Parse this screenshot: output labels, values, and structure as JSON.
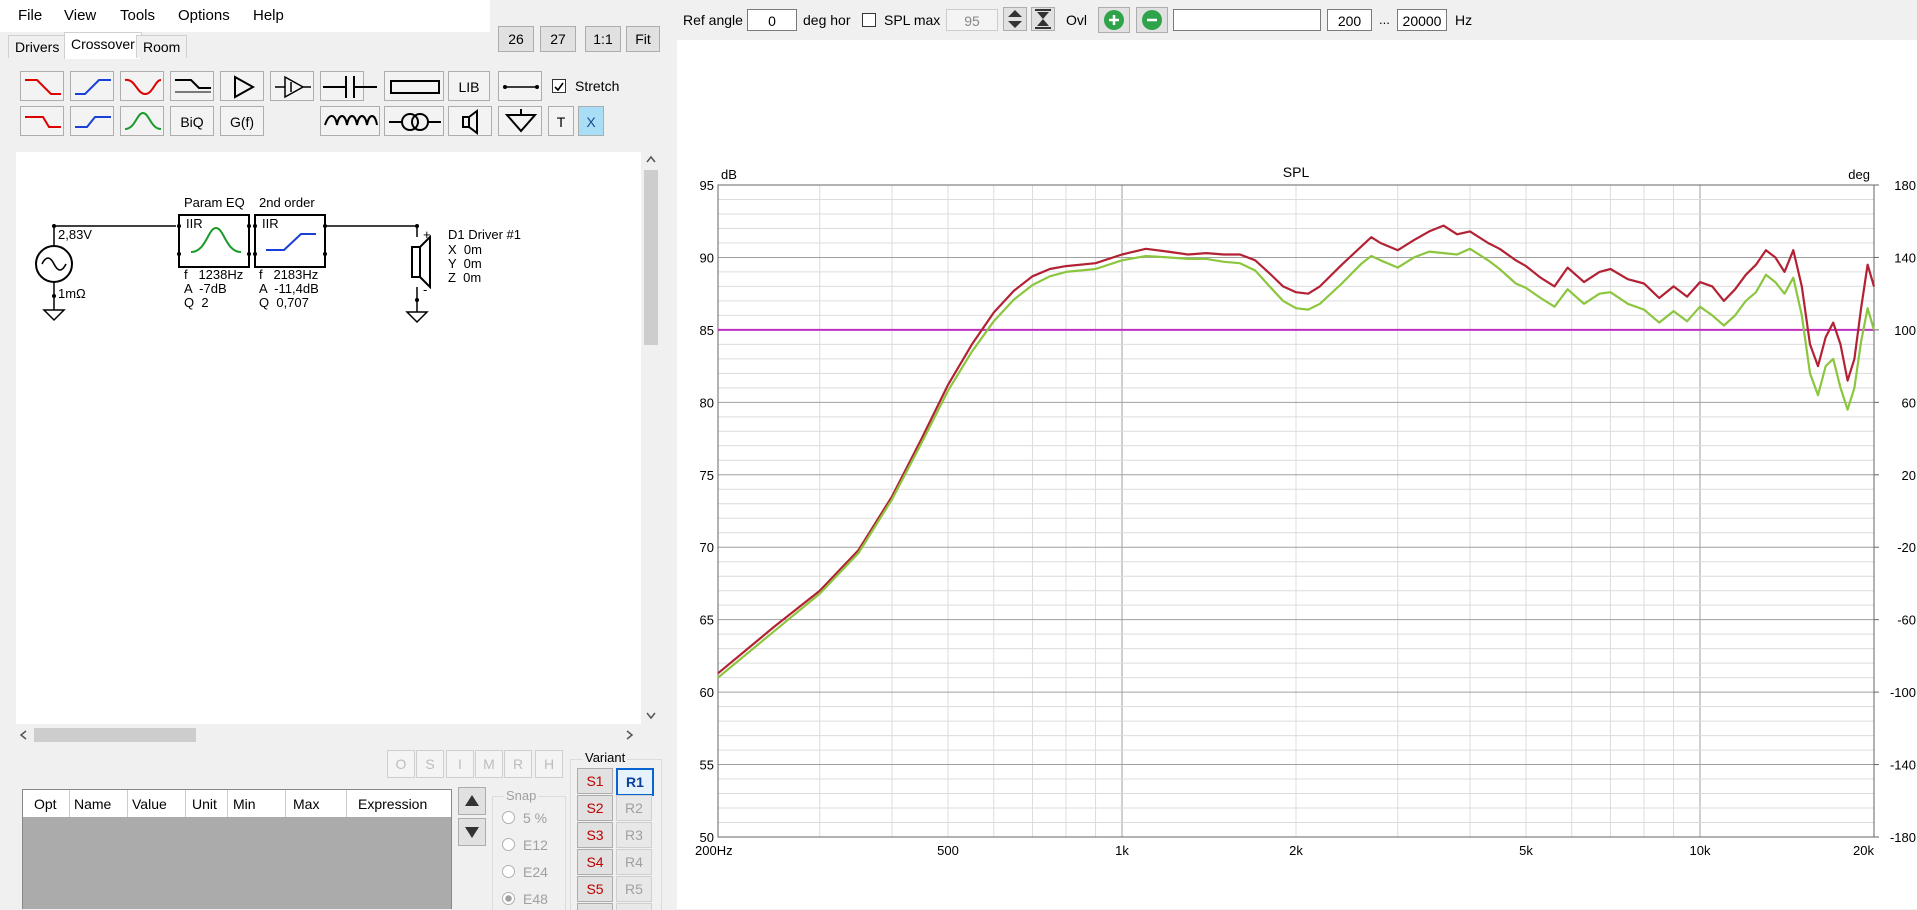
{
  "menu": {
    "items": [
      "File",
      "View",
      "Tools",
      "Options",
      "Help"
    ]
  },
  "tabs": [
    "Drivers",
    "Crossover",
    "Room"
  ],
  "view_buttons": {
    "b1": "26",
    "b2": "27",
    "b3": "1:1",
    "b4": "Fit"
  },
  "toolbar": {
    "lib": "LIB",
    "biq": "BiQ",
    "gf": "G(f)",
    "t": "T",
    "x": "X",
    "stretch_label": "Stretch",
    "stretch_checked": true
  },
  "schematic": {
    "source_voltage": "2,83V",
    "source_impedance": "1mΩ",
    "block1": {
      "title": "Param EQ",
      "type": "IIR",
      "f": "f   1238Hz",
      "a": "A  -7dB",
      "q": "Q  2"
    },
    "block2": {
      "title": "2nd order",
      "type": "IIR",
      "f": "f   2183Hz",
      "a": "A  -11,4dB",
      "q": "Q  0,707"
    },
    "driver": {
      "name": "D1 Driver #1",
      "x": "X  0m",
      "y": "Y  0m",
      "z": "Z  0m",
      "plus": "+",
      "minus": "-"
    }
  },
  "opt_buttons": [
    "O",
    "S",
    "I",
    "M",
    "R",
    "H"
  ],
  "param_grid": {
    "columns": [
      "Opt",
      "Name",
      "Value",
      "Unit",
      "Min",
      "Max",
      "Expression"
    ]
  },
  "snap": {
    "label": "Snap",
    "options": [
      "5 %",
      "E12",
      "E24",
      "E48"
    ],
    "selected": "E48"
  },
  "variant": {
    "label": "Variant",
    "s": [
      "S1",
      "S2",
      "S3",
      "S4",
      "S5"
    ],
    "r": [
      "R1",
      "R2",
      "R3",
      "R4",
      "R5"
    ],
    "active_r": "R1"
  },
  "topbar": {
    "ref_angle_label": "Ref angle",
    "ref_angle_value": "0",
    "deg_hor_label": "deg hor",
    "spl_max_label": "SPL max",
    "spl_max_value": "95",
    "ovl_label": "Ovl",
    "freq_text": "",
    "freq_min": "200",
    "ellipsis": "...",
    "freq_max": "20000",
    "hz_label": "Hz"
  },
  "colors": {
    "series1": "#b22234",
    "series2": "#8cc63f",
    "ref_line": "#c030c0",
    "grid_major": "#a0a0a0",
    "grid_minor": "#dcdcdc"
  },
  "chart_data": {
    "type": "line",
    "title": "SPL",
    "ylabel_left": "dB",
    "ylabel_right": "deg",
    "x_scale": "log",
    "xlim": [
      200,
      20000
    ],
    "ylim_left": [
      50,
      95
    ],
    "ylim_right": [
      -180,
      180
    ],
    "x_tick_labels": [
      {
        "v": 200,
        "t": "200Hz"
      },
      {
        "v": 500,
        "t": "500"
      },
      {
        "v": 1000,
        "t": "1k"
      },
      {
        "v": 2000,
        "t": "2k"
      },
      {
        "v": 5000,
        "t": "5k"
      },
      {
        "v": 10000,
        "t": "10k"
      },
      {
        "v": 20000,
        "t": "20k"
      }
    ],
    "y_left_ticks": [
      95,
      90,
      85,
      80,
      75,
      70,
      65,
      60,
      55,
      50
    ],
    "y_right_ticks": [
      180,
      140,
      100,
      60,
      20,
      -20,
      -60,
      -100,
      -140,
      -180
    ],
    "ref_line": 85,
    "series": [
      {
        "color": "#b22234",
        "points": [
          [
            200,
            61.3
          ],
          [
            250,
            64.5
          ],
          [
            300,
            67
          ],
          [
            350,
            69.8
          ],
          [
            400,
            73.5
          ],
          [
            450,
            77.5
          ],
          [
            500,
            81.2
          ],
          [
            550,
            84
          ],
          [
            600,
            86.2
          ],
          [
            650,
            87.7
          ],
          [
            700,
            88.7
          ],
          [
            750,
            89.2
          ],
          [
            800,
            89.4
          ],
          [
            900,
            89.6
          ],
          [
            1000,
            90.2
          ],
          [
            1100,
            90.6
          ],
          [
            1200,
            90.4
          ],
          [
            1300,
            90.2
          ],
          [
            1400,
            90.3
          ],
          [
            1500,
            90.2
          ],
          [
            1600,
            90.2
          ],
          [
            1700,
            89.8
          ],
          [
            1800,
            88.9
          ],
          [
            1900,
            88.0
          ],
          [
            2000,
            87.6
          ],
          [
            2100,
            87.5
          ],
          [
            2200,
            88.0
          ],
          [
            2400,
            89.5
          ],
          [
            2600,
            90.8
          ],
          [
            2700,
            91.4
          ],
          [
            2800,
            91.0
          ],
          [
            3000,
            90.5
          ],
          [
            3200,
            91.2
          ],
          [
            3400,
            91.8
          ],
          [
            3600,
            92.2
          ],
          [
            3800,
            91.6
          ],
          [
            4000,
            91.8
          ],
          [
            4300,
            91.0
          ],
          [
            4500,
            90.6
          ],
          [
            4800,
            89.8
          ],
          [
            5000,
            89.4
          ],
          [
            5300,
            88.6
          ],
          [
            5600,
            88.0
          ],
          [
            5900,
            89.3
          ],
          [
            6300,
            88.3
          ],
          [
            6700,
            89.0
          ],
          [
            7000,
            89.2
          ],
          [
            7500,
            88.5
          ],
          [
            8000,
            88.2
          ],
          [
            8500,
            87.2
          ],
          [
            9000,
            88.0
          ],
          [
            9500,
            87.3
          ],
          [
            10000,
            88.3
          ],
          [
            10500,
            88.0
          ],
          [
            11000,
            87.0
          ],
          [
            11500,
            87.8
          ],
          [
            12000,
            88.8
          ],
          [
            12500,
            89.5
          ],
          [
            13000,
            90.5
          ],
          [
            13500,
            90.0
          ],
          [
            14000,
            89.0
          ],
          [
            14500,
            90.5
          ],
          [
            15000,
            88.0
          ],
          [
            15500,
            84.0
          ],
          [
            16000,
            82.5
          ],
          [
            16500,
            84.5
          ],
          [
            17000,
            85.5
          ],
          [
            17500,
            84.0
          ],
          [
            18000,
            81.5
          ],
          [
            18500,
            83.0
          ],
          [
            19000,
            86.5
          ],
          [
            19500,
            89.5
          ],
          [
            20000,
            88.0
          ]
        ]
      },
      {
        "color": "#8cc63f",
        "points": [
          [
            200,
            61.0
          ],
          [
            250,
            64.2
          ],
          [
            300,
            66.8
          ],
          [
            350,
            69.6
          ],
          [
            400,
            73.3
          ],
          [
            450,
            77.2
          ],
          [
            500,
            80.8
          ],
          [
            550,
            83.5
          ],
          [
            600,
            85.6
          ],
          [
            650,
            87.1
          ],
          [
            700,
            88.1
          ],
          [
            750,
            88.7
          ],
          [
            800,
            89.0
          ],
          [
            900,
            89.2
          ],
          [
            1000,
            89.8
          ],
          [
            1100,
            90.1
          ],
          [
            1200,
            90.0
          ],
          [
            1300,
            89.9
          ],
          [
            1400,
            89.9
          ],
          [
            1500,
            89.7
          ],
          [
            1600,
            89.6
          ],
          [
            1700,
            89.1
          ],
          [
            1800,
            88.0
          ],
          [
            1900,
            87.0
          ],
          [
            2000,
            86.5
          ],
          [
            2100,
            86.4
          ],
          [
            2200,
            86.8
          ],
          [
            2400,
            88.2
          ],
          [
            2600,
            89.6
          ],
          [
            2700,
            90.1
          ],
          [
            2800,
            89.8
          ],
          [
            3000,
            89.3
          ],
          [
            3200,
            90.0
          ],
          [
            3400,
            90.4
          ],
          [
            3600,
            90.3
          ],
          [
            3800,
            90.2
          ],
          [
            4000,
            90.6
          ],
          [
            4300,
            89.8
          ],
          [
            4500,
            89.2
          ],
          [
            4800,
            88.2
          ],
          [
            5000,
            87.9
          ],
          [
            5300,
            87.2
          ],
          [
            5600,
            86.6
          ],
          [
            5900,
            87.8
          ],
          [
            6300,
            86.8
          ],
          [
            6700,
            87.5
          ],
          [
            7000,
            87.6
          ],
          [
            7500,
            86.8
          ],
          [
            8000,
            86.4
          ],
          [
            8500,
            85.5
          ],
          [
            9000,
            86.3
          ],
          [
            9500,
            85.6
          ],
          [
            10000,
            86.6
          ],
          [
            10500,
            86.0
          ],
          [
            11000,
            85.3
          ],
          [
            11500,
            86.0
          ],
          [
            12000,
            87.0
          ],
          [
            12500,
            87.6
          ],
          [
            13000,
            88.8
          ],
          [
            13500,
            88.3
          ],
          [
            14000,
            87.5
          ],
          [
            14500,
            88.6
          ],
          [
            15000,
            86.0
          ],
          [
            15500,
            82.0
          ],
          [
            16000,
            80.5
          ],
          [
            16500,
            82.5
          ],
          [
            17000,
            83.0
          ],
          [
            17500,
            81.0
          ],
          [
            18000,
            79.5
          ],
          [
            18500,
            81.0
          ],
          [
            19000,
            84.2
          ],
          [
            19500,
            86.5
          ],
          [
            20000,
            85.0
          ]
        ]
      }
    ]
  }
}
